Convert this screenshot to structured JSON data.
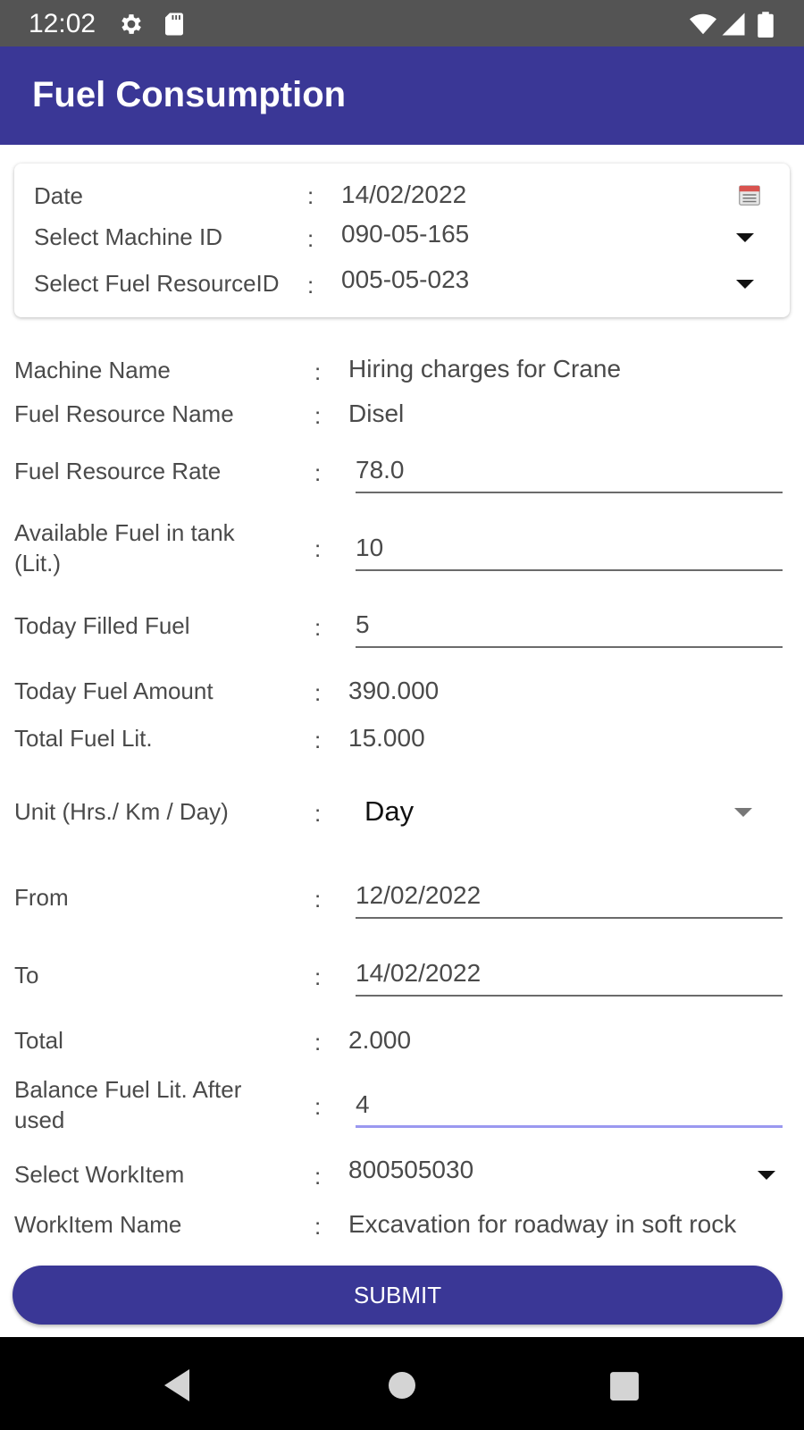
{
  "status_bar": {
    "time": "12:02"
  },
  "app_bar": {
    "title": "Fuel Consumption"
  },
  "header_card": {
    "date": {
      "label": "Date",
      "value": "14/02/2022"
    },
    "machine": {
      "label": "Select Machine ID",
      "value": "090-05-165"
    },
    "fuel_resource": {
      "label": "Select Fuel ResourceID",
      "value": "005-05-023"
    }
  },
  "form": {
    "separator": ":",
    "machine_name": {
      "label": "Machine Name",
      "value": "Hiring  charges for Crane"
    },
    "fuel_resource_name": {
      "label": "Fuel Resource Name",
      "value": "Disel"
    },
    "fuel_resource_rate": {
      "label": "Fuel Resource Rate",
      "value": "78.0"
    },
    "available_fuel": {
      "label_line1": "Available Fuel in tank",
      "label_line2": "(Lit.)",
      "value": "10"
    },
    "today_filled": {
      "label": "Today Filled Fuel",
      "value": "5"
    },
    "today_amount": {
      "label": "Today Fuel Amount",
      "value": "390.000"
    },
    "total_fuel": {
      "label": "Total Fuel Lit.",
      "value": "15.000"
    },
    "unit": {
      "label": "Unit (Hrs./ Km / Day)",
      "value": "Day"
    },
    "from": {
      "label": "From",
      "value": "12/02/2022"
    },
    "to": {
      "label": "To",
      "value": "14/02/2022"
    },
    "total": {
      "label": "Total",
      "value": "2.000"
    },
    "balance": {
      "label_line1": "Balance Fuel Lit. After",
      "label_line2": "used",
      "value": "4"
    },
    "work_item": {
      "label": "Select WorkItem",
      "value": "800505030"
    },
    "work_item_name": {
      "label": "WorkItem Name",
      "value": "Excavation for roadway in soft rock"
    }
  },
  "submit_label": "SUBMIT",
  "colors": {
    "primary": "#3a3796",
    "status_bar": "#545454",
    "focus_underline": "#9a98f0"
  },
  "icons": [
    "gear-icon",
    "sd-card-icon",
    "wifi-icon",
    "signal-icon",
    "battery-icon",
    "calendar-icon",
    "back-icon",
    "home-icon",
    "recents-icon"
  ]
}
